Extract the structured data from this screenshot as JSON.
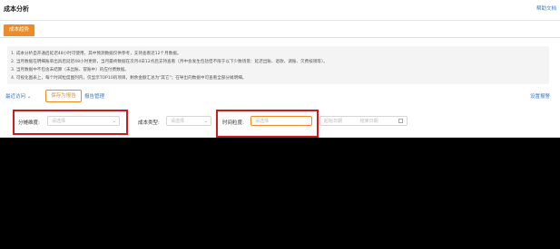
{
  "header": {
    "title": "成本分析",
    "help_link": "帮助文档"
  },
  "tabs": [
    {
      "label": "成本趋势",
      "active": true
    }
  ],
  "notice": {
    "lines": [
      "1. 成本分析自开通后延迟48小时可使用，其中预测数据仅供参考，支持查看近12个月数据。",
      "2. 当月数据在明细账单出具后延迟48小时更新，当月最终数据在次月4日12点后支持查看（月中会发生包括但不限于以下少数场景：延迟出账、退款、调账、欠费核销等）。",
      "3. 当月数据中不包含未结算（未出账、冒账中）的应付费数据。",
      "4. 可视化图表上，每个时间粒度图列内，仅显示TOP10的项目，剩余金额汇总为\"其它\"；在导出的数据中可查看全部分摊明细。"
    ]
  },
  "toolbar": {
    "recent_label": "最近访问 ⌄",
    "save_report_label": "保存为报告",
    "report_manage_label": "报告管理",
    "settings_label": "设置报警"
  },
  "filters": {
    "dimension": {
      "label": "分摊维度:",
      "placeholder": "请选择"
    },
    "cost_type": {
      "label": "成本类型:",
      "placeholder": "请选择"
    },
    "time_granularity": {
      "label": "时间粒度:",
      "placeholder": "请选择"
    },
    "date_range": {
      "start_placeholder": "起始日期",
      "end_placeholder": "结束日期"
    }
  },
  "colors": {
    "accent": "#ef8a26",
    "link": "#3a78c3",
    "highlight": "#d11a1a"
  }
}
